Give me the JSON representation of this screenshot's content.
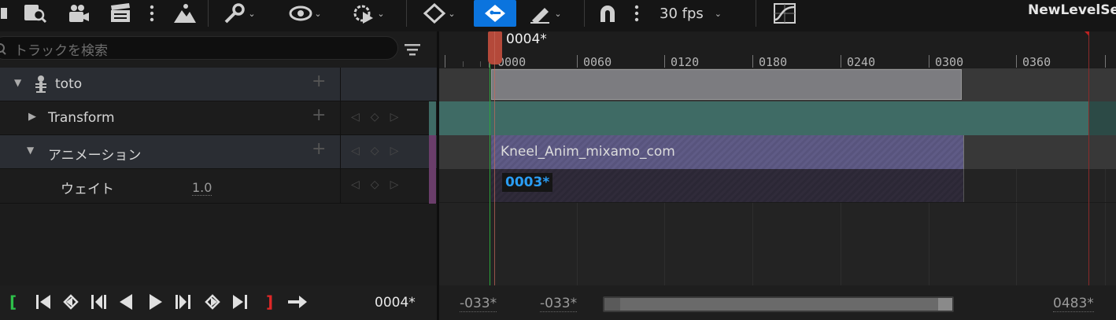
{
  "toolbar": {
    "fps_label": "30 fps",
    "sequence_name": "NewLevelSeq"
  },
  "search": {
    "placeholder": "トラックを検索"
  },
  "tracks": [
    {
      "label": "toto"
    },
    {
      "label": "Transform"
    },
    {
      "label": "アニメーション"
    },
    {
      "label": "ウェイト",
      "value": "1.0"
    }
  ],
  "timeline": {
    "playhead_label": "0004*",
    "ticks": [
      "0000",
      "0060",
      "0120",
      "0180",
      "0240",
      "0300",
      "0360"
    ],
    "clip_name": "Kneel_Anim_mixamo_com",
    "clip_frame": "0003*"
  },
  "bottom": {
    "current_frame": "0004*",
    "view_start": "-033*",
    "view_start2": "-033*",
    "view_end": "0483*"
  },
  "colors": {
    "accent": "#0b74de",
    "transform_track": "#3f6b65",
    "anim_clip": "#5f5b86",
    "playhead": "#b4493a"
  }
}
